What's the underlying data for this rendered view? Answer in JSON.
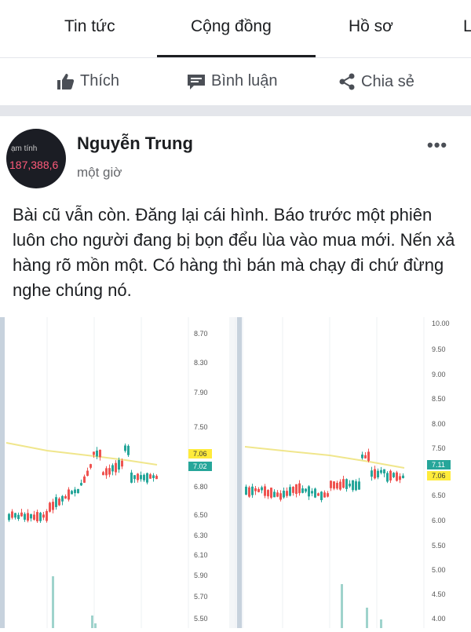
{
  "tabs": [
    {
      "label": "Tin tức"
    },
    {
      "label": "Cộng đồng"
    },
    {
      "label": "Hồ sơ"
    },
    {
      "label": "L"
    }
  ],
  "actions": {
    "like": "Thích",
    "comment": "Bình luận",
    "share": "Chia sẻ"
  },
  "post": {
    "avatar_line1": "ạm tính",
    "avatar_line2": "187,388,6",
    "author": "Nguyễn Trung",
    "time": "một giờ",
    "text": "Bài cũ vẫn còn. Đăng lại cái hình. Báo trước một phiên luôn cho người đang bị bọn đểu lùa vào mua mới. Nến xả hàng rõ mồn một. Có hàng thì bán mà chạy đi chứ đừng nghe chúng nó."
  },
  "charts": {
    "left_axis": [
      "8.70",
      "8.30",
      "7.90",
      "7.50",
      "7.06",
      "7.02",
      "6.80",
      "6.50",
      "6.30",
      "6.10",
      "5.90",
      "5.70",
      "5.50"
    ],
    "left_tag_yellow": "7.06",
    "left_tag_green": "7.02",
    "right_axis": [
      "10.00",
      "9.50",
      "9.00",
      "8.50",
      "8.00",
      "7.50",
      "7.11",
      "7.06",
      "6.50",
      "6.00",
      "5.50",
      "5.00",
      "4.50",
      "4.00"
    ],
    "right_tag_green": "7.11",
    "right_tag_yellow": "7.06",
    "colors": {
      "up": "#26a69a",
      "down": "#ef5350",
      "ma": "#f0e68c",
      "tag_yellow": "#ffeb3b",
      "tag_green": "#26a69a"
    }
  }
}
